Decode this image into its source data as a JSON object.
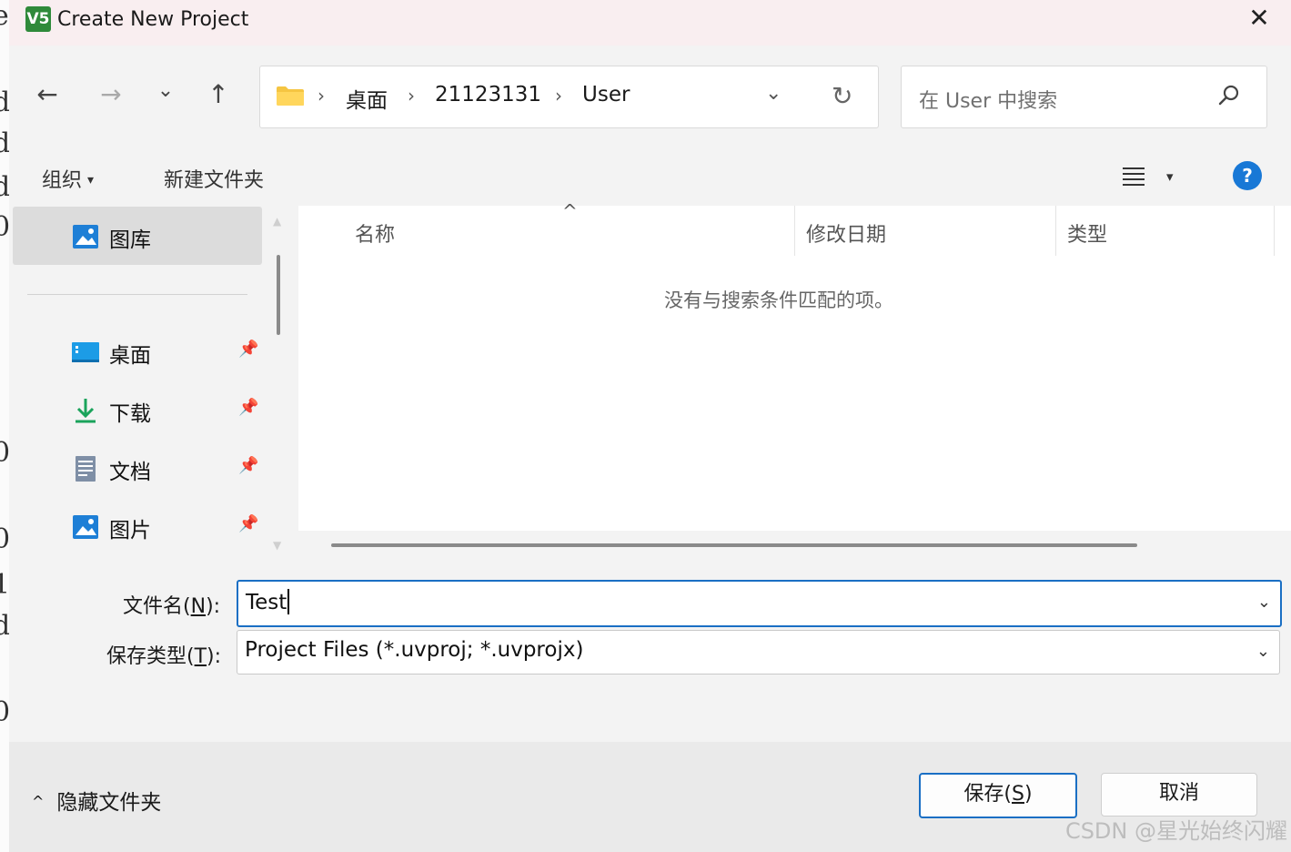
{
  "dialog": {
    "title": "Create New Project",
    "app_icon_text": "V5",
    "close_glyph": "✕"
  },
  "nav": {
    "back_glyph": "←",
    "forward_glyph": "→",
    "recent_glyph": "⌄",
    "up_glyph": "↑"
  },
  "address": {
    "crumbs": [
      "桌面",
      "21123131",
      "User"
    ],
    "sep": "›",
    "dropdown_glyph": "⌄",
    "refresh_glyph": "↻"
  },
  "search": {
    "placeholder": "在 User 中搜索"
  },
  "toolbar": {
    "organize": "组织",
    "organize_caret": "▾",
    "new_folder": "新建文件夹",
    "view_caret": "▾",
    "help": "?"
  },
  "sidebar": {
    "gallery": "图库",
    "items": [
      {
        "label": "桌面",
        "icon": "desktop-icon"
      },
      {
        "label": "下载",
        "icon": "download-icon"
      },
      {
        "label": "文档",
        "icon": "document-icon"
      },
      {
        "label": "图片",
        "icon": "pictures-icon"
      }
    ],
    "pin_glyph": "📌"
  },
  "filelist": {
    "columns": [
      "名称",
      "修改日期",
      "类型"
    ],
    "sort_glyph": "^",
    "empty_message": "没有与搜索条件匹配的项。"
  },
  "form": {
    "filename_label_prefix": "文件名(",
    "filename_label_key": "N",
    "filename_label_suffix": "):",
    "filename_value": "Test",
    "filetype_label_prefix": "保存类型(",
    "filetype_label_key": "T",
    "filetype_label_suffix": "):",
    "filetype_value": "Project Files (*.uvproj; *.uvprojx)",
    "caret": "⌄"
  },
  "footer": {
    "hide_folders": "隐藏文件夹",
    "hide_chevron": "^",
    "save_prefix": "保存(",
    "save_key": "S",
    "save_suffix": ")",
    "cancel": "取消"
  },
  "watermark": "CSDN @星光始终闪耀",
  "colors": {
    "accent": "#1a6fc4",
    "titlebar": "#f9eef0",
    "dialog_bg": "#f3f3f3",
    "folder_yellow": "#f5c542"
  }
}
